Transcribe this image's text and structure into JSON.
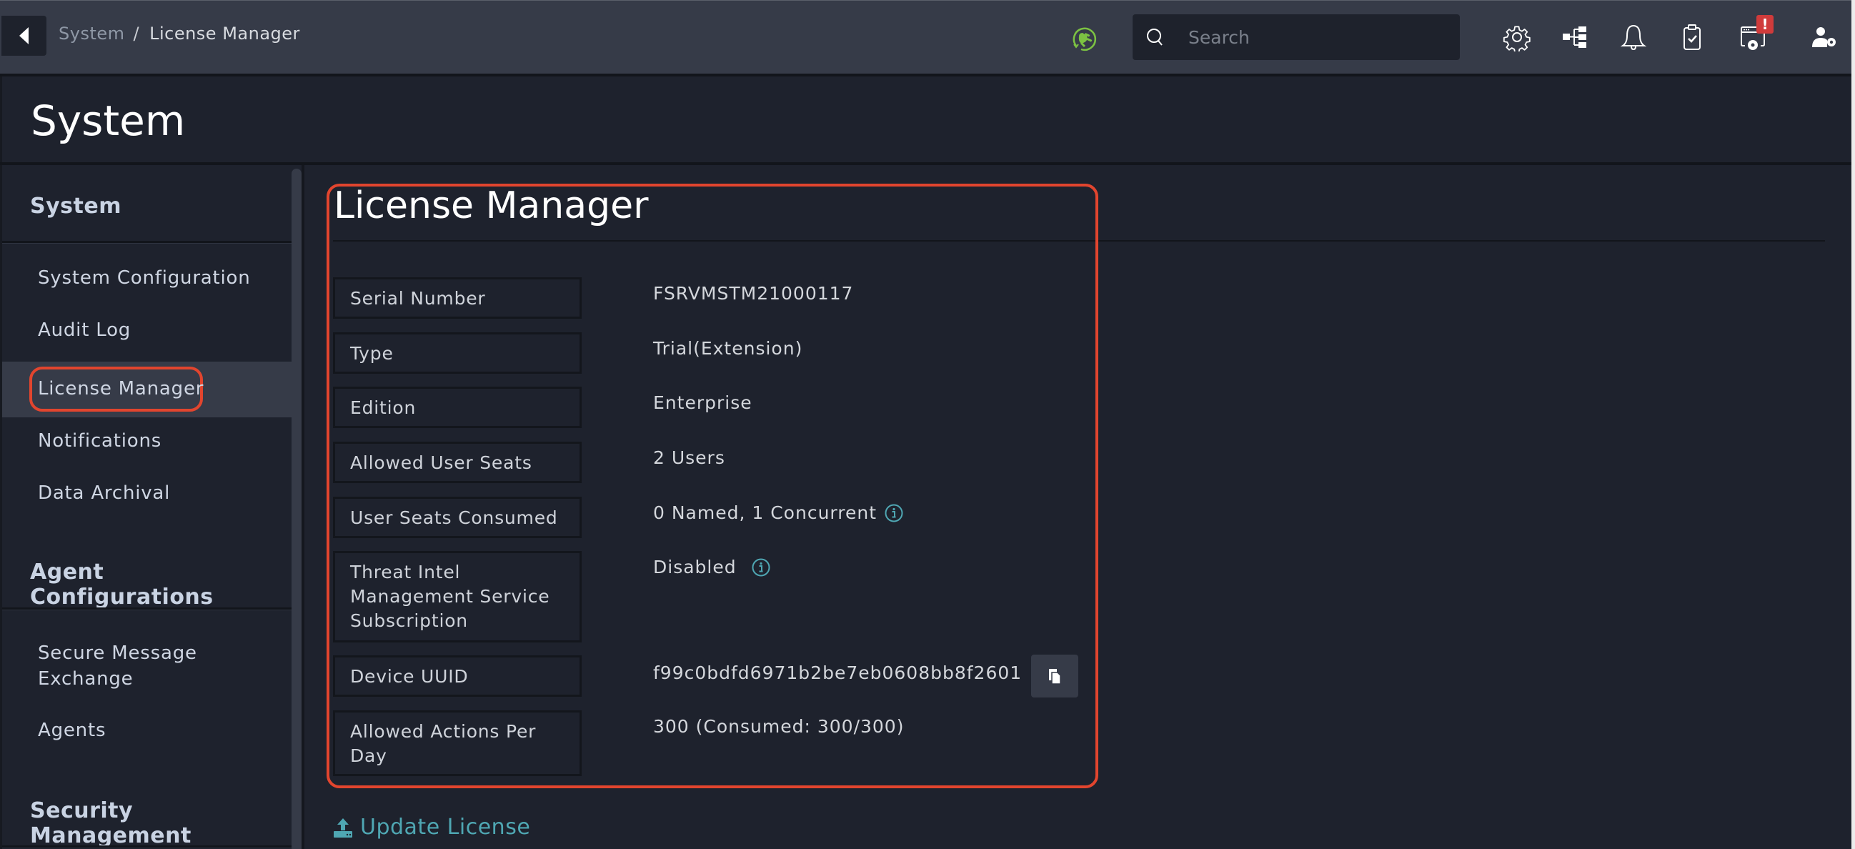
{
  "header": {
    "back_label": "Back",
    "breadcrumb": {
      "parent": "System",
      "separator": "/",
      "current": "License Manager"
    },
    "status_icon": "connected-plug-icon",
    "status_color": "#7cc242",
    "search": {
      "placeholder": "Search",
      "value": ""
    },
    "icons": [
      "settings-gear-icon",
      "hierarchy-tree-icon",
      "notification-bell-icon",
      "approvals-clipboard-icon",
      "system-health-icon",
      "user-settings-icon"
    ],
    "system_alert_badge": "!",
    "badge_color": "#d03b3b"
  },
  "page": {
    "title": "System"
  },
  "sidebar": {
    "sections": [
      {
        "title": "System",
        "items": [
          {
            "label": "System Configuration",
            "active": false
          },
          {
            "label": "Audit Log",
            "active": false
          },
          {
            "label": "License Manager",
            "active": true
          },
          {
            "label": "Notifications",
            "active": false
          },
          {
            "label": "Data Archival",
            "active": false
          }
        ]
      },
      {
        "title": "Agent Configurations",
        "items": [
          {
            "label": "Secure Message Exchange",
            "active": false
          },
          {
            "label": "Agents",
            "active": false
          }
        ]
      },
      {
        "title": "Security Management",
        "items": []
      }
    ]
  },
  "license": {
    "title": "License Manager",
    "fields": [
      {
        "label": "Serial Number",
        "value": "FSRVMSTM21000117"
      },
      {
        "label": "Type",
        "value": "Trial(Extension)"
      },
      {
        "label": "Edition",
        "value": "Enterprise"
      },
      {
        "label": "Allowed User Seats",
        "value": "2 Users"
      },
      {
        "label": "User Seats Consumed",
        "value": "0 Named, 1 Concurrent",
        "info": true
      },
      {
        "label": "Threat Intel Management Service Subscription",
        "value": "Disabled",
        "info": true
      },
      {
        "label": "Device UUID",
        "value": "f99c0bdfd6971b2be7eb0608bb8f2601",
        "copy": true
      },
      {
        "label": "Allowed Actions Per Day",
        "value": "300 (Consumed: 300/300)"
      }
    ],
    "update_button": "Update License",
    "accent_color": "#4fa7b3",
    "annotation_color": "#e2452e"
  }
}
